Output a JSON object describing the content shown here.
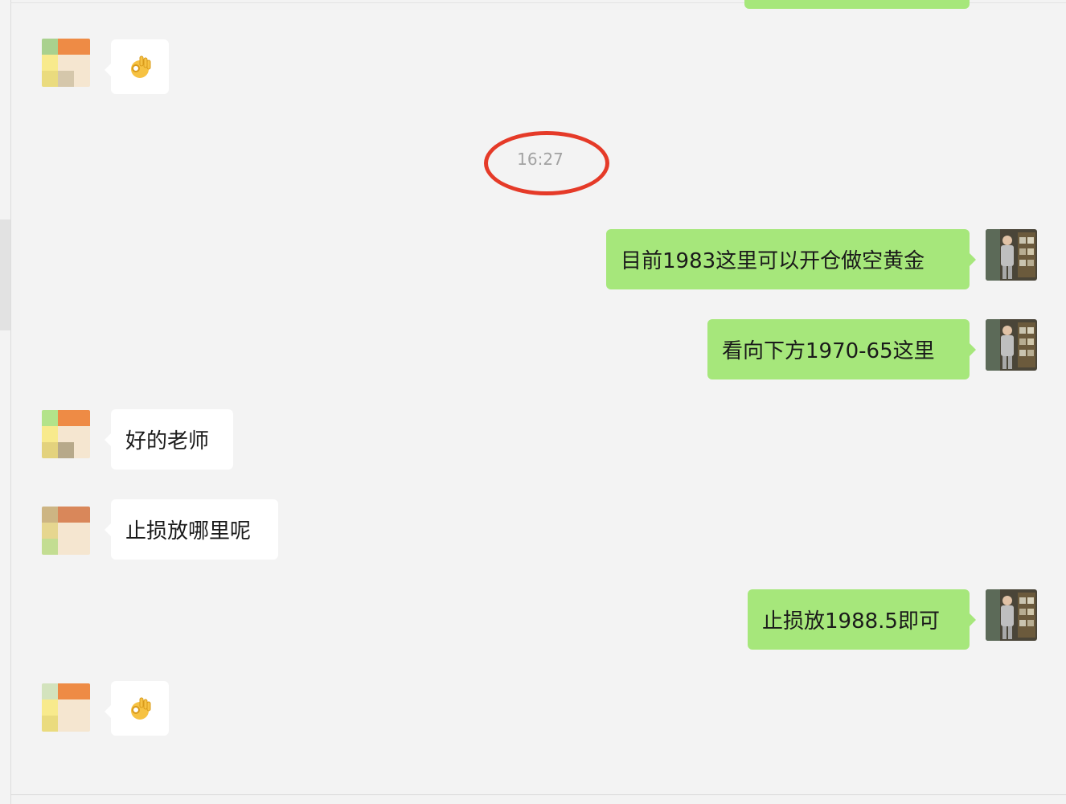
{
  "timestamp": "16:27",
  "colors": {
    "background": "#f3f3f3",
    "bubble_sent": "#a6e77b",
    "bubble_received": "#ffffff",
    "highlight_ellipse": "#e53a28",
    "timestamp_text": "#a2a2a2"
  },
  "messages": [
    {
      "side": "left",
      "type": "emoji",
      "icon": "ok-hand-emoji"
    },
    {
      "side": "right",
      "type": "text",
      "text": "目前1983这里可以开仓做空黄金"
    },
    {
      "side": "right",
      "type": "text",
      "text": "看向下方1970-65这里"
    },
    {
      "side": "left",
      "type": "text",
      "text": "好的老师"
    },
    {
      "side": "left",
      "type": "text",
      "text": "止损放哪里呢"
    },
    {
      "side": "right",
      "type": "text",
      "text": "止损放1988.5即可"
    },
    {
      "side": "left",
      "type": "emoji",
      "icon": "ok-hand-emoji"
    }
  ]
}
